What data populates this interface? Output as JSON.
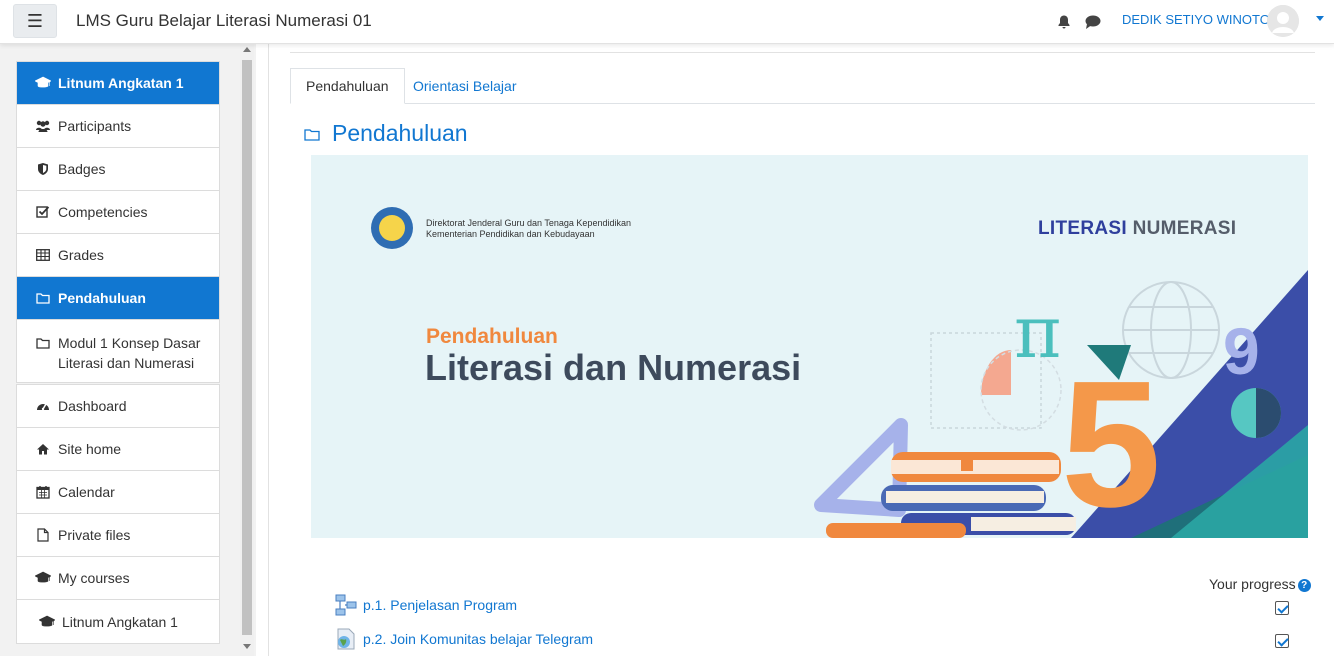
{
  "header": {
    "menu_icon": "hamburger-icon",
    "site_title": "LMS Guru Belajar Literasi Numerasi 01",
    "user_name": "DEDIK SETIYO WINOTO"
  },
  "sidebar": {
    "course_group": [
      {
        "label": "Litnum Angkatan 1",
        "icon": "graduation-cap-icon",
        "active": true
      },
      {
        "label": "Participants",
        "icon": "users-icon"
      },
      {
        "label": "Badges",
        "icon": "shield-icon"
      },
      {
        "label": "Competencies",
        "icon": "checkbox-icon"
      },
      {
        "label": "Grades",
        "icon": "table-icon"
      },
      {
        "label": "Pendahuluan",
        "icon": "folder-icon",
        "active": true
      },
      {
        "label": "Modul 1 Konsep Dasar Literasi dan Numerasi",
        "icon": "folder-icon"
      }
    ],
    "site_group": [
      {
        "label": "Dashboard",
        "icon": "tachometer-icon"
      },
      {
        "label": "Site home",
        "icon": "home-icon"
      },
      {
        "label": "Calendar",
        "icon": "calendar-icon"
      },
      {
        "label": "Private files",
        "icon": "file-icon"
      },
      {
        "label": "My courses",
        "icon": "graduation-cap-icon"
      }
    ],
    "course_item": {
      "label": "Litnum Angkatan 1",
      "icon": "graduation-cap-icon"
    }
  },
  "tabs": [
    {
      "label": "Pendahuluan",
      "active": true
    },
    {
      "label": "Orientasi Belajar",
      "active": false
    }
  ],
  "section": {
    "title": "Pendahuluan"
  },
  "banner": {
    "org_line1": "Direktorat Jenderal Guru dan Tenaga Kependidikan",
    "org_line2": "Kementerian Pendidikan dan Kebudayaan",
    "brand_part1": "LITERASI",
    "brand_part2": "NUMERASI",
    "subtitle": "Pendahuluan",
    "headline": "Literasi dan Numerasi",
    "pi": "π",
    "nine": "9",
    "five": "5"
  },
  "progress": {
    "label": "Your progress"
  },
  "activities": [
    {
      "label": "p.1. Penjelasan Program",
      "icon": "page-icon",
      "completed": true
    },
    {
      "label": "p.2. Join Komunitas belajar Telegram",
      "icon": "url-icon",
      "completed": true
    }
  ],
  "colors": {
    "primary": "#1177d1",
    "orange": "#f0883e",
    "navy": "#3d4a5c",
    "teal": "#2aa6a4",
    "indigo": "#3b4ea8"
  }
}
